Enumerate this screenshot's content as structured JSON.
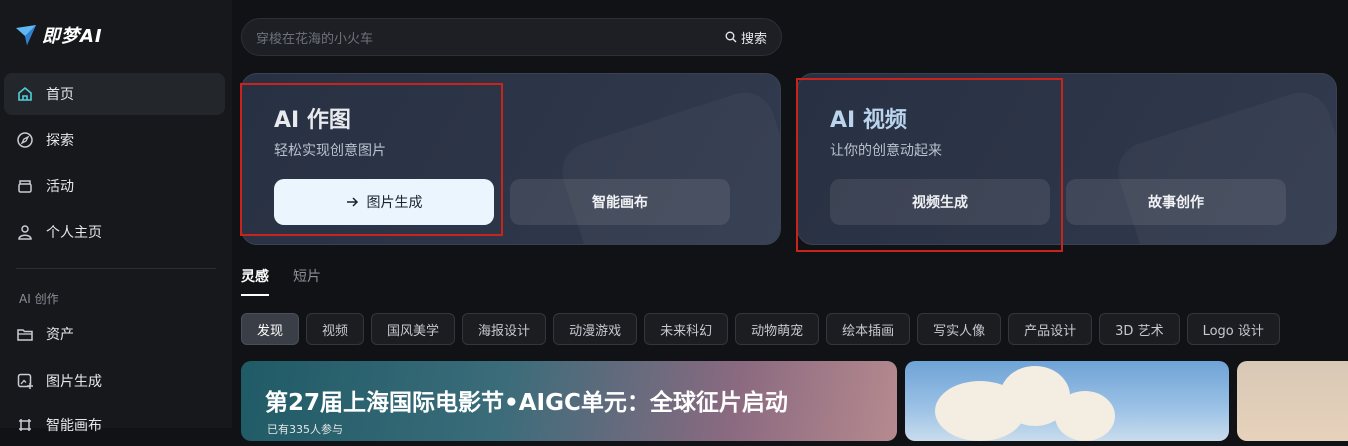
{
  "brand": {
    "name": "即梦AI"
  },
  "sidebar": {
    "items": [
      {
        "label": "首页",
        "icon": "home-icon",
        "active": true
      },
      {
        "label": "探索",
        "icon": "compass-icon"
      },
      {
        "label": "活动",
        "icon": "gift-icon"
      },
      {
        "label": "个人主页",
        "icon": "user-icon"
      }
    ],
    "section_label": "AI 创作",
    "create_items": [
      {
        "label": "资产",
        "icon": "folder-icon"
      },
      {
        "label": "图片生成",
        "icon": "image-gen-icon"
      },
      {
        "label": "智能画布",
        "icon": "canvas-icon"
      }
    ]
  },
  "search": {
    "placeholder": "穿梭在花海的小火车",
    "button_label": "搜索"
  },
  "cards": {
    "image": {
      "title": "AI 作图",
      "subtitle": "轻松实现创意图片",
      "primary_button": "图片生成",
      "secondary_button": "智能画布"
    },
    "video": {
      "title": "AI 视频",
      "subtitle": "让你的创意动起来",
      "primary_button": "视频生成",
      "secondary_button": "故事创作"
    }
  },
  "tabs": [
    {
      "label": "灵感",
      "active": true
    },
    {
      "label": "短片"
    }
  ],
  "chips": [
    "发现",
    "视频",
    "国风美学",
    "海报设计",
    "动漫游戏",
    "未来科幻",
    "动物萌宠",
    "绘本插画",
    "写实人像",
    "产品设计",
    "3D 艺术",
    "Logo 设计"
  ],
  "banner": {
    "title": "第27届上海国际电影节•AIGC单元：全球征片启动",
    "meta": "已有335人参与"
  },
  "colors": {
    "highlight": "#c8241c",
    "accent_card": "#2d3548",
    "primary_button": "#eaf5fd"
  }
}
